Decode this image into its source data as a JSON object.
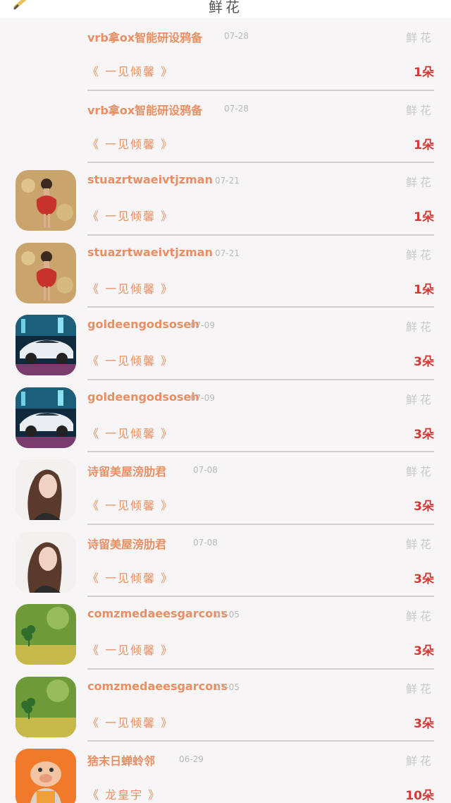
{
  "header": {
    "title": "鲜花"
  },
  "rows": [
    {
      "name": "vrb拿ox智能研设鸦备",
      "date": "07-28",
      "kind": "鲜花",
      "book": "《 一见倾馨 》",
      "count": "1朵",
      "avatar": ""
    },
    {
      "name": "vrb拿ox智能研设鸦备",
      "date": "07-28",
      "kind": "鲜花",
      "book": "《 一见倾馨 》",
      "count": "1朵",
      "avatar": ""
    },
    {
      "name": "stuazrtwaeivtjzman",
      "date": "07-21",
      "kind": "鲜花",
      "book": "《 一见倾馨 》",
      "count": "1朵",
      "avatar": "girl-rose-avatar"
    },
    {
      "name": "stuazrtwaeivtjzman",
      "date": "07-21",
      "kind": "鲜花",
      "book": "《 一见倾馨 》",
      "count": "1朵",
      "avatar": "girl-rose-avatar"
    },
    {
      "name": "goldeengodsoseh",
      "date": "07-09",
      "kind": "鲜花",
      "book": "《 一见倾馨 》",
      "count": "3朵",
      "avatar": "sports-car-avatar"
    },
    {
      "name": "goldeengodsoseh",
      "date": "07-09",
      "kind": "鲜花",
      "book": "《 一见倾馨 》",
      "count": "3朵",
      "avatar": "sports-car-avatar"
    },
    {
      "name": "诗留美屋滂肋君",
      "date": "07-08",
      "kind": "鲜花",
      "book": "《 一见倾馨 》",
      "count": "3朵",
      "avatar": "woman-portrait-avatar"
    },
    {
      "name": "诗留美屋滂肋君",
      "date": "07-08",
      "kind": "鲜花",
      "book": "《 一见倾馨 》",
      "count": "3朵",
      "avatar": "woman-portrait-avatar"
    },
    {
      "name": "comzmedaeesgarcons",
      "date": "07-05",
      "kind": "鲜花",
      "book": "《 一见倾馨 》",
      "count": "3朵",
      "avatar": "clover-avatar"
    },
    {
      "name": "comzmedaeesgarcons",
      "date": "07-05",
      "kind": "鲜花",
      "book": "《 一见倾馨 》",
      "count": "3朵",
      "avatar": "clover-avatar"
    },
    {
      "name": "猞末日蝉蛉邻",
      "date": "06-29",
      "kind": "鲜花",
      "book": "《 龙皇宇 》",
      "count": "10朵",
      "avatar": "cartoon-pig-avatar"
    }
  ]
}
